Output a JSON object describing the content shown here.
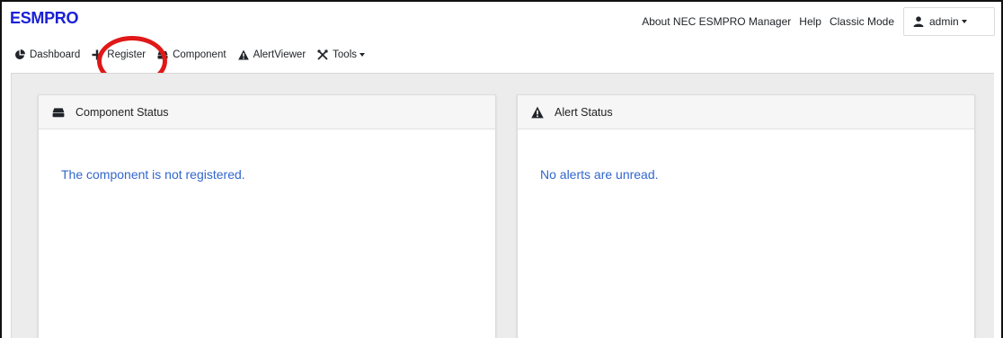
{
  "app": {
    "title": "ESMPRO"
  },
  "topnav": {
    "about": "About NEC ESMPRO Manager",
    "help": "Help",
    "classic": "Classic Mode",
    "user": "admin",
    "user_icon": "user-icon"
  },
  "mainnav": {
    "items": [
      {
        "label": "Dashboard",
        "icon": "pie-chart-icon"
      },
      {
        "label": "Register",
        "icon": "plus-icon"
      },
      {
        "label": "Component",
        "icon": "server-icon"
      },
      {
        "label": "AlertViewer",
        "icon": "warning-icon"
      },
      {
        "label": "Tools",
        "icon": "tools-icon"
      }
    ]
  },
  "cards": {
    "component": {
      "title": "Component Status",
      "message": "The component is not registered.",
      "icon": "server-icon"
    },
    "alert": {
      "title": "Alert Status",
      "message": "No alerts are unread.",
      "icon": "warning-icon"
    }
  },
  "colors": {
    "brand": "#1a20d6",
    "message": "#3366cc",
    "annotation": "#e01818",
    "background": "#ececec"
  }
}
